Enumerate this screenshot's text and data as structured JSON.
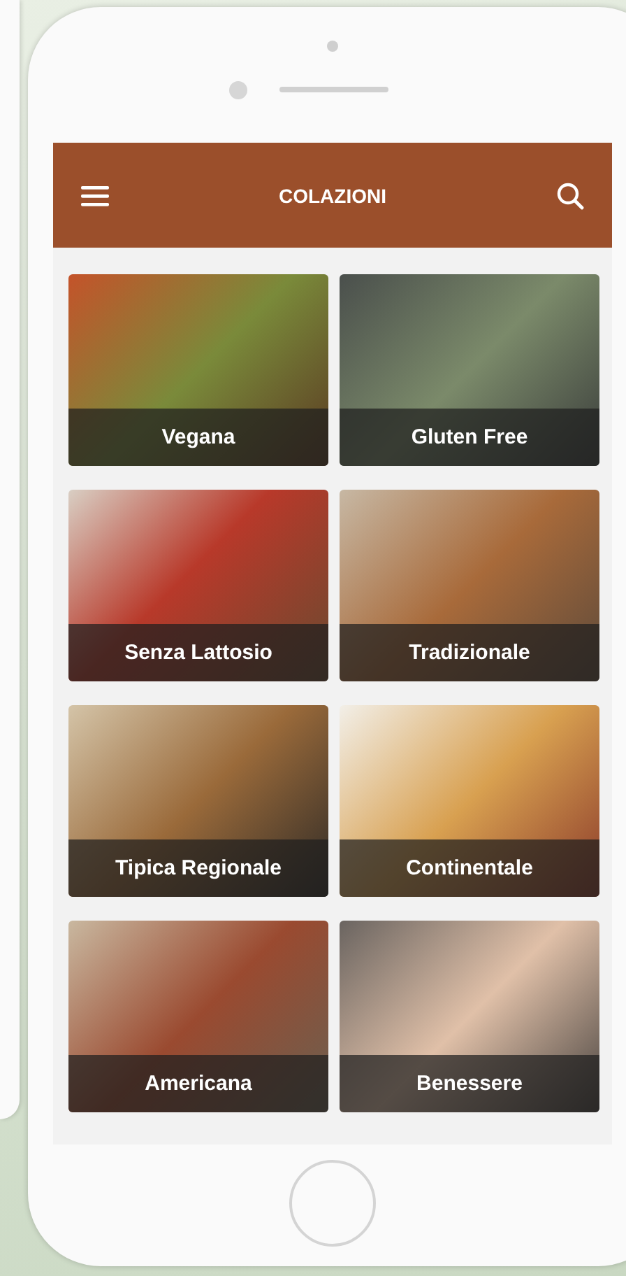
{
  "header": {
    "title": "COLAZIONI"
  },
  "categories": [
    {
      "label": "Vegana"
    },
    {
      "label": "Gluten Free"
    },
    {
      "label": "Senza Lattosio"
    },
    {
      "label": "Tradizionale"
    },
    {
      "label": "Tipica Regionale"
    },
    {
      "label": "Continentale"
    },
    {
      "label": "Americana"
    },
    {
      "label": "Benessere"
    }
  ]
}
